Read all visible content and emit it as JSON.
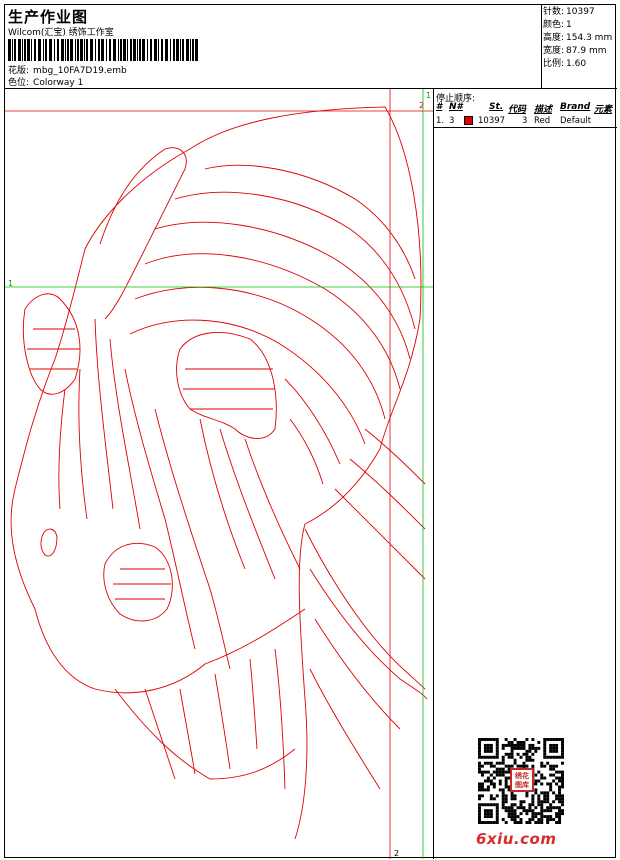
{
  "header": {
    "title": "生产作业图",
    "subtitle": "Wilcom(汇宝) 绣饰工作室",
    "design_label": "花版:",
    "design_value": "mbg_10FA7D19.emb",
    "colorway_label": "色位:",
    "colorway_value": "Colorway 1"
  },
  "stats": [
    {
      "label": "针数:",
      "value": "10397"
    },
    {
      "label": "颜色:",
      "value": "1"
    },
    {
      "label": "高度:",
      "value": "154.3 mm"
    },
    {
      "label": "宽度:",
      "value": "87.9 mm"
    },
    {
      "label": "比例:",
      "value": "1.60"
    }
  ],
  "stops": {
    "title": "停止顺序:",
    "columns": [
      "#",
      "N#",
      "St.",
      "代码",
      "描述",
      "Brand",
      "元素"
    ],
    "rows": [
      {
        "idx": "1.",
        "needle": "3",
        "stitches": "10397",
        "code": "3",
        "desc": "Red",
        "brand": "Default",
        "color": "#e00000"
      }
    ]
  },
  "markers": {
    "top_right_1": "1",
    "top_right_2": "2",
    "left_1": "1",
    "bottom_2": "2"
  },
  "colors": {
    "thread": "#e00000",
    "guide_green": "#00c000",
    "guide_red": "#e00000"
  },
  "logo": {
    "site": "6xiu.com",
    "seal_text": "绣花图库"
  }
}
